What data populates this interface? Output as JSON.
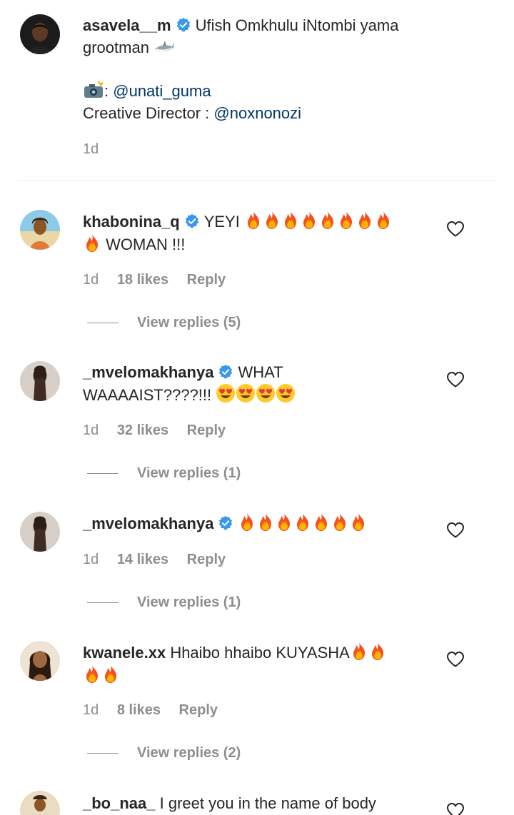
{
  "caption": {
    "username": "asavela__m",
    "text_line1": "Ufish Omkhulu iNtombi yama",
    "text_line2": "grootman",
    "credit_line": ":",
    "photo_mention": "@unati_guma",
    "director_label": "Creative Director :",
    "director_mention": "@noxnonozi",
    "time": "1d"
  },
  "comments": [
    {
      "username": "khabonina_q",
      "text": "YEYI",
      "line2_text": "WOMAN !!!",
      "time": "1d",
      "likes": "18 likes",
      "reply": "Reply",
      "view_replies": "View replies (5)"
    },
    {
      "username": "_mvelomakhanya",
      "text": "WHAT",
      "line2_text": "WAAAAIST????!!!",
      "time": "1d",
      "likes": "32 likes",
      "reply": "Reply",
      "view_replies": "View replies (1)"
    },
    {
      "username": "_mvelomakhanya",
      "text": "",
      "time": "1d",
      "likes": "14 likes",
      "reply": "Reply",
      "view_replies": "View replies (1)"
    },
    {
      "username": "kwanele.xx",
      "text": "Hhaibo hhaibo KUYASHA",
      "time": "1d",
      "likes": "8 likes",
      "reply": "Reply",
      "view_replies": "View replies (2)"
    },
    {
      "username": "_bo_naa_",
      "text": "I greet you in the name of body"
    }
  ],
  "colors": {
    "verified": "#3897f0",
    "mention": "#00376b",
    "meta": "#8e8e8e"
  }
}
